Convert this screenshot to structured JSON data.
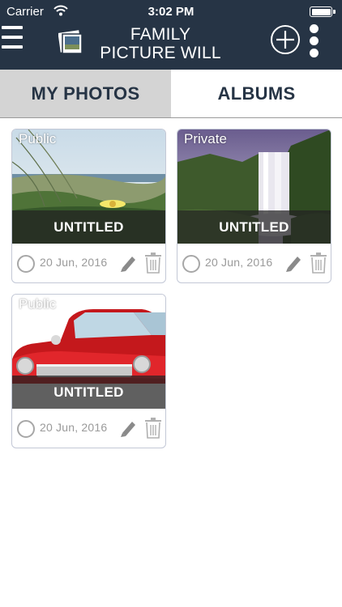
{
  "status_bar": {
    "carrier": "Carrier",
    "time": "3:02 PM"
  },
  "nav": {
    "title_line1": "FAMILY",
    "title_line2": "PICTURE WILL"
  },
  "tabs": [
    {
      "label": "MY PHOTOS",
      "active": true
    },
    {
      "label": "ALBUMS",
      "active": false
    }
  ],
  "albums": [
    {
      "privacy": "Public",
      "name": "UNTITLED",
      "date": "20 Jun, 2016",
      "photo": "beach-dunes-with-flower"
    },
    {
      "privacy": "Private",
      "name": "UNTITLED",
      "date": "20 Jun, 2016",
      "photo": "waterfall"
    },
    {
      "privacy": "Public",
      "name": "UNTITLED",
      "date": "20 Jun, 2016",
      "photo": "red-vintage-car"
    }
  ],
  "colors": {
    "nav_bg": "#263445",
    "tab_active_bg": "#d4d4d4",
    "tab_text": "#263445",
    "card_border": "#c3c8d6",
    "footer_gray": "#9a9a9a"
  },
  "icons": [
    "wifi-icon",
    "battery-icon",
    "menu-icon",
    "photo-logo-icon",
    "add-icon",
    "more-icon",
    "select-circle-icon",
    "pencil-icon",
    "trash-icon"
  ]
}
